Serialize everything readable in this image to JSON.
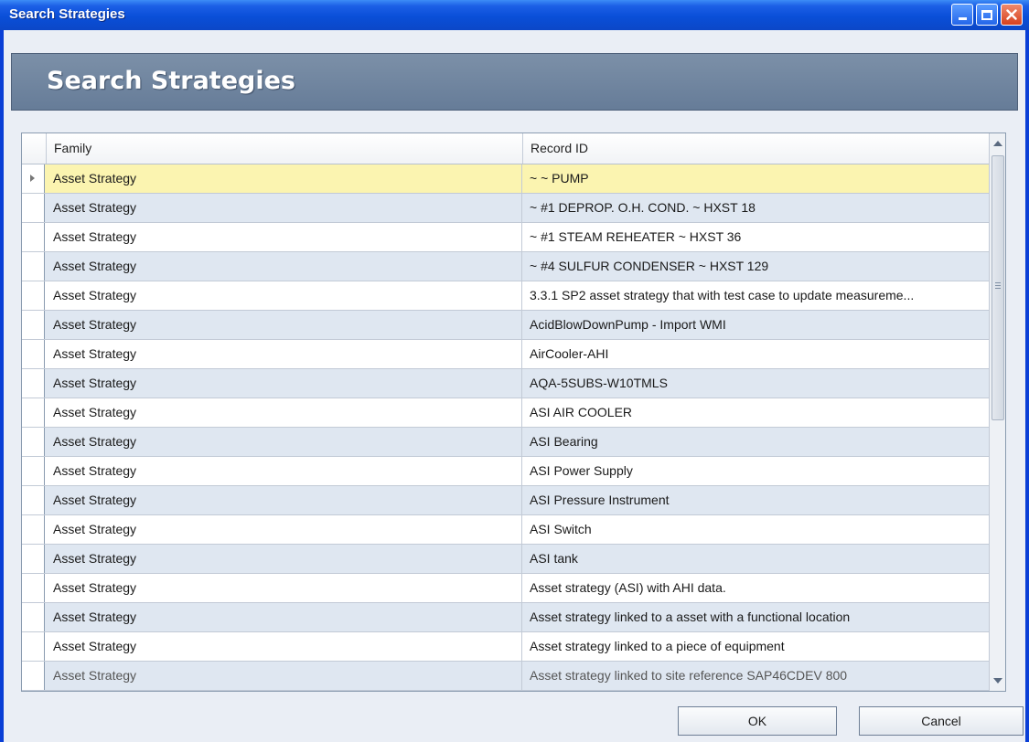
{
  "window": {
    "title": "Search Strategies"
  },
  "header": {
    "title": "Search Strategies"
  },
  "grid": {
    "columns": [
      "Family",
      "Record ID"
    ],
    "selected_index": 0,
    "rows": [
      {
        "family": "Asset Strategy",
        "record_id": "~ ~ PUMP"
      },
      {
        "family": "Asset Strategy",
        "record_id": "~ #1 DEPROP. O.H. COND. ~ HXST 18"
      },
      {
        "family": "Asset Strategy",
        "record_id": "~ #1 STEAM REHEATER ~ HXST 36"
      },
      {
        "family": "Asset Strategy",
        "record_id": "~ #4 SULFUR CONDENSER ~ HXST 129"
      },
      {
        "family": "Asset Strategy",
        "record_id": "3.3.1 SP2 asset strategy that with test case to update measureme..."
      },
      {
        "family": "Asset Strategy",
        "record_id": "AcidBlowDownPump - Import WMI"
      },
      {
        "family": "Asset Strategy",
        "record_id": "AirCooler-AHI"
      },
      {
        "family": "Asset Strategy",
        "record_id": "AQA-5SUBS-W10TMLS"
      },
      {
        "family": "Asset Strategy",
        "record_id": "ASI AIR COOLER"
      },
      {
        "family": "Asset Strategy",
        "record_id": "ASI Bearing"
      },
      {
        "family": "Asset Strategy",
        "record_id": "ASI Power Supply"
      },
      {
        "family": "Asset Strategy",
        "record_id": "ASI Pressure Instrument"
      },
      {
        "family": "Asset Strategy",
        "record_id": "ASI Switch"
      },
      {
        "family": "Asset Strategy",
        "record_id": "ASI tank"
      },
      {
        "family": "Asset Strategy",
        "record_id": "Asset strategy (ASI) with AHI data."
      },
      {
        "family": "Asset Strategy",
        "record_id": "Asset strategy linked to a asset with a functional location"
      },
      {
        "family": "Asset Strategy",
        "record_id": "Asset strategy linked to a piece of equipment"
      },
      {
        "family": "Asset Strategy",
        "record_id": "Asset strategy linked to site reference SAP46CDEV 800"
      }
    ]
  },
  "buttons": {
    "ok": "OK",
    "cancel": "Cancel"
  },
  "colors": {
    "titlebar": "#0a4fd8",
    "header_band": "#7088a4",
    "selected_row": "#fbf4b0",
    "alt_row": "#dfe7f1"
  },
  "icons": {
    "minimize": "minimize-icon",
    "maximize": "maximize-icon",
    "close": "close-icon",
    "row_pointer": "row-pointer-icon"
  }
}
